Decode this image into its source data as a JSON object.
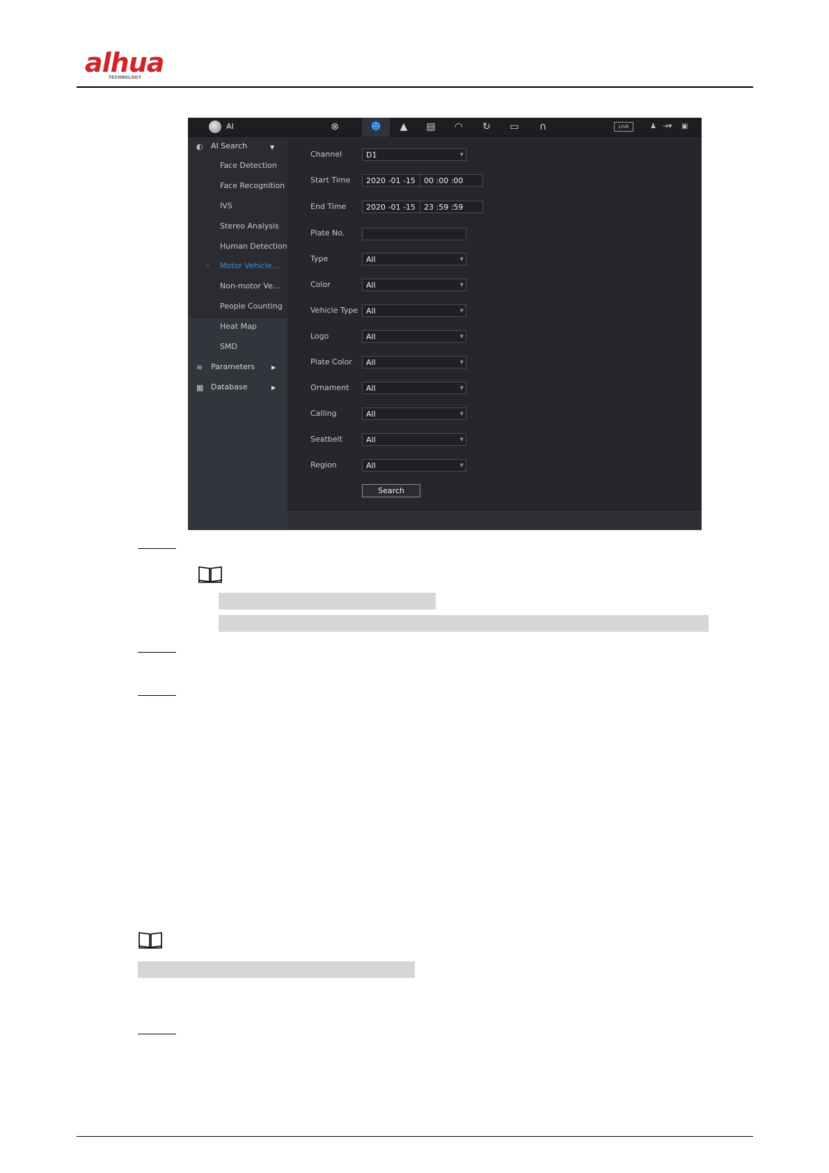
{
  "brand": {
    "logo_text": "alhua",
    "logo_sub": "TECHNOLOGY",
    "primary_color": "#d2232a"
  },
  "topbar": {
    "title": "AI",
    "live_badge": "LIVE",
    "icons": [
      "ai-brain-icon",
      "film-reel-icon",
      "ai-face-icon",
      "alarm-bell-icon",
      "storage-icon",
      "speedometer-icon",
      "refresh-icon",
      "monitor-icon",
      "headset-icon",
      "user-icon",
      "logout-icon",
      "fullscreen-icon"
    ]
  },
  "sidebar": {
    "ai_search": "AI Search",
    "items": [
      "Face Detection",
      "Face Recognition",
      "IVS",
      "Stereo Analysis",
      "Human Detection",
      "Motor Vehicle...",
      "Non-motor Ve...",
      "People Counting",
      "Heat Map",
      "SMD"
    ],
    "active_item": "Motor Vehicle...",
    "parameters": "Parameters",
    "database": "Database"
  },
  "form": {
    "channel": {
      "label": "Channel",
      "value": "D1"
    },
    "start_time": {
      "label": "Start Time",
      "date": "2020 -01 -15",
      "time": "00 :00 :00"
    },
    "end_time": {
      "label": "End Time",
      "date": "2020 -01 -15",
      "time": "23 :59 :59"
    },
    "plate_no": {
      "label": "Plate No.",
      "value": ""
    },
    "type": {
      "label": "Type",
      "value": "All"
    },
    "color": {
      "label": "Color",
      "value": "All"
    },
    "vehicle_type": {
      "label": "Vehicle Type",
      "value": "All"
    },
    "logo": {
      "label": "Logo",
      "value": "All"
    },
    "plate_color": {
      "label": "Plate Color",
      "value": "All"
    },
    "ornament": {
      "label": "Ornament",
      "value": "All"
    },
    "calling": {
      "label": "Calling",
      "value": "All"
    },
    "seatbelt": {
      "label": "Seatbelt",
      "value": "All"
    },
    "region": {
      "label": "Region",
      "value": "All"
    },
    "search_button": "Search"
  }
}
